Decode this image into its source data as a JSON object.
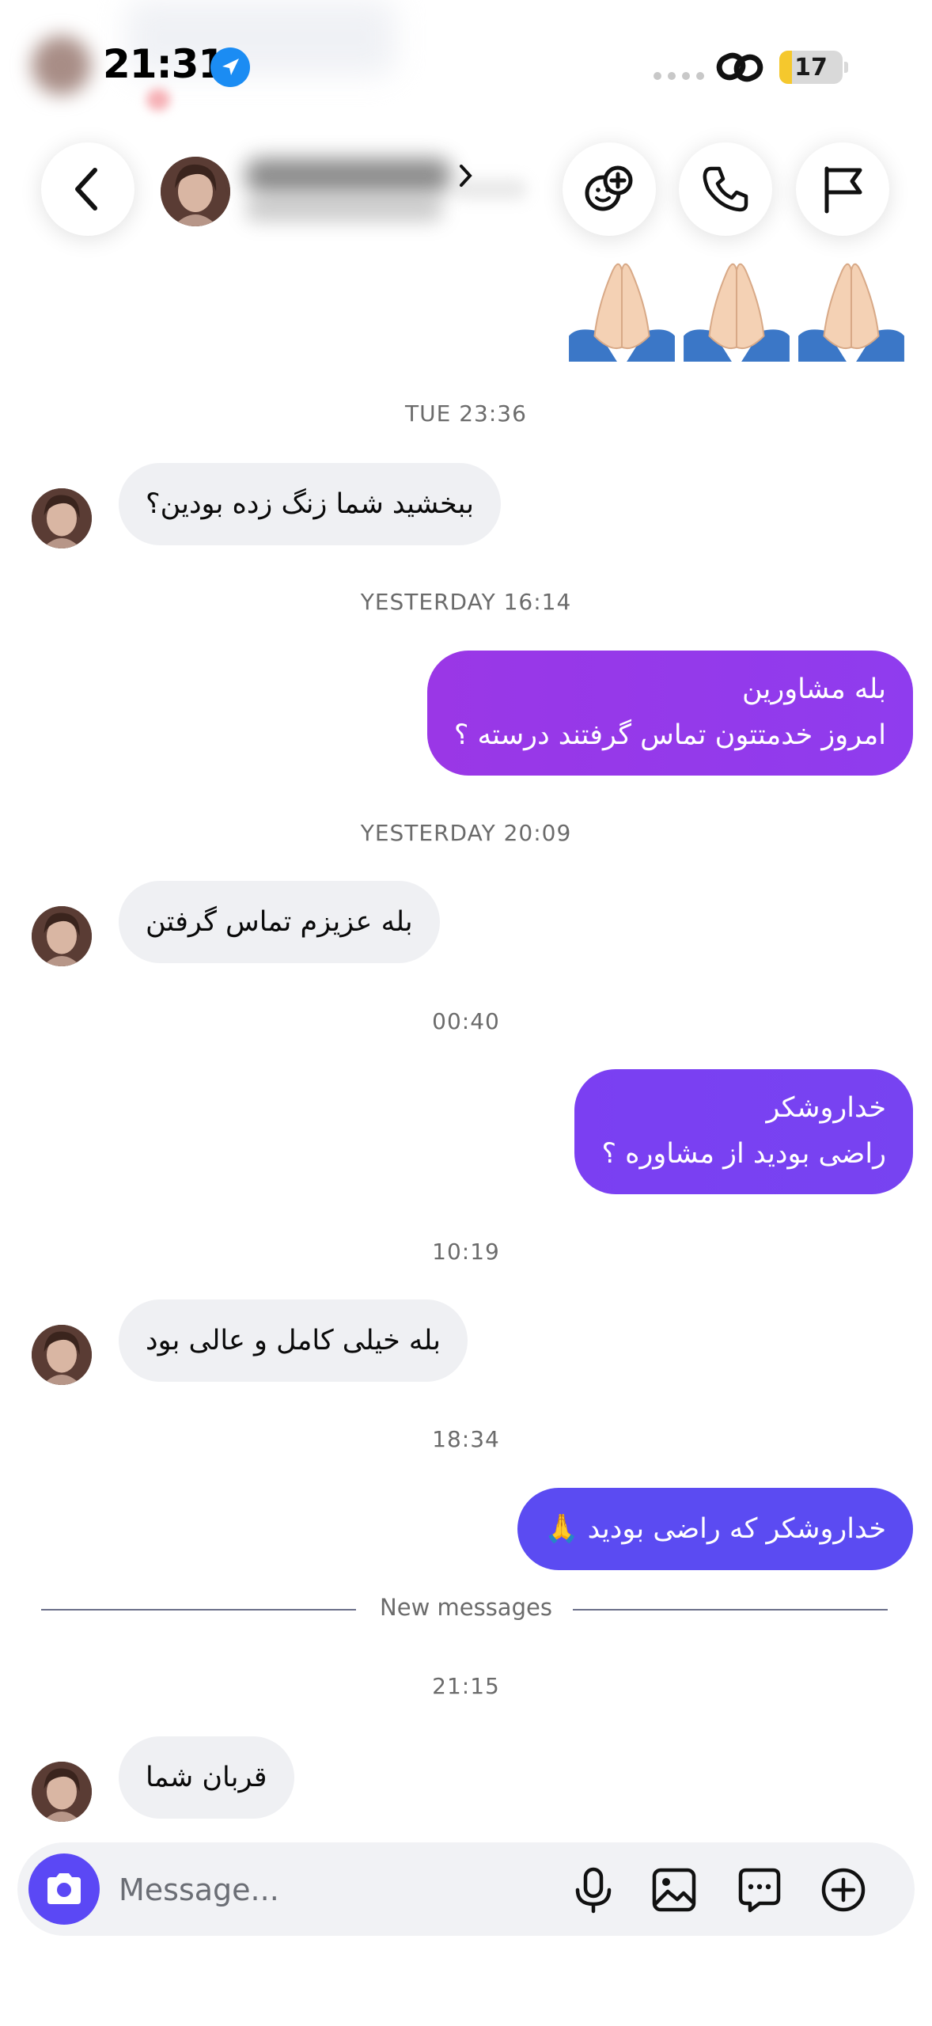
{
  "status_bar": {
    "time": "21:31",
    "battery": "17"
  },
  "header": {
    "back_icon": "chevron-left-icon",
    "actions": [
      "effects-icon",
      "phone-icon",
      "flag-icon"
    ]
  },
  "emoji_row": "🙏🏻🙏🏻🙏🏻",
  "conversation": [
    {
      "type": "timestamp",
      "text": "TUE 23:36"
    },
    {
      "type": "incoming",
      "text": "ببخشید شما زنگ زده بودین؟"
    },
    {
      "type": "timestamp",
      "text": "YESTERDAY 16:14"
    },
    {
      "type": "outgoing",
      "lines": [
        "بله مشاورین",
        "امروز خدمتتون تماس گرفتند درسته ؟"
      ]
    },
    {
      "type": "timestamp",
      "text": "YESTERDAY 20:09"
    },
    {
      "type": "incoming",
      "text": "بله عزیزم تماس گرفتن"
    },
    {
      "type": "timestamp",
      "text": "00:40"
    },
    {
      "type": "outgoing",
      "lines": [
        "خداروشکر",
        "راضی بودید از مشاوره ؟"
      ]
    },
    {
      "type": "timestamp",
      "text": "10:19"
    },
    {
      "type": "incoming",
      "text": "بله خیلی کامل و عالی بود"
    },
    {
      "type": "timestamp",
      "text": "18:34"
    },
    {
      "type": "outgoing",
      "text": "خداروشکر که راضی بودید 🙏"
    },
    {
      "type": "divider",
      "text": "New messages"
    },
    {
      "type": "timestamp",
      "text": "21:15"
    },
    {
      "type": "incoming",
      "text": "قربان شما"
    }
  ],
  "composer": {
    "placeholder": "Message...",
    "icons": [
      "camera-icon",
      "microphone-icon",
      "image-icon",
      "sticker-icon",
      "plus-icon"
    ]
  },
  "colors": {
    "outgoing_1": "#9a38e8",
    "outgoing_2": "#7b3ff2",
    "outgoing_3": "#5b4bf2",
    "incoming_bg": "#eff0f3",
    "camera_button": "#5b48f5"
  }
}
